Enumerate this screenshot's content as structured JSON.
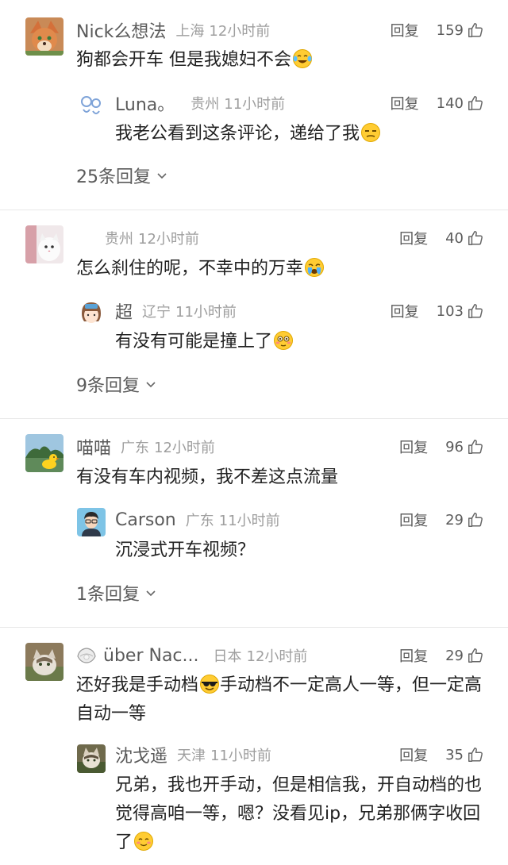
{
  "actions": {
    "reply_label": "回复"
  },
  "threads": [
    {
      "comment": {
        "username": "Nick么想法",
        "location": "上海",
        "time": "12小时前",
        "likes": "159",
        "text": "狗都会开车 但是我媳妇不会"
      },
      "reply": {
        "username": "Luna。",
        "location": "贵州",
        "time": "11小时前",
        "likes": "140",
        "text": "我老公看到这条评论，递给了我"
      },
      "more_replies": "25条回复"
    },
    {
      "comment": {
        "username": "",
        "location": "贵州",
        "time": "12小时前",
        "likes": "40",
        "text": "怎么刹住的呢，不幸中的万幸"
      },
      "reply": {
        "username": "超",
        "location": "辽宁",
        "time": "11小时前",
        "likes": "103",
        "text": "有没有可能是撞上了"
      },
      "more_replies": "9条回复"
    },
    {
      "comment": {
        "username": "喵喵",
        "location": "广东",
        "time": "12小时前",
        "likes": "96",
        "text": "有没有车内视频，我不差这点流量"
      },
      "reply": {
        "username": "Carson",
        "location": "广东",
        "time": "11小时前",
        "likes": "29",
        "text": "沉浸式开车视频？"
      },
      "more_replies": "1条回复"
    },
    {
      "comment": {
        "username": "über Nac...",
        "location": "日本",
        "time": "12小时前",
        "likes": "29",
        "text_a": "还好我是手动档",
        "text_b": "手动档不一定高人一等，但一定高自动一等"
      },
      "reply": {
        "username": "沈戈遥",
        "location": "天津",
        "time": "11小时前",
        "likes": "35",
        "text": "兄弟，我也开手动，但是相信我，开自动档的也觉得高咱一等，嗯？没看见ip，兄弟那俩字收回了"
      }
    }
  ]
}
